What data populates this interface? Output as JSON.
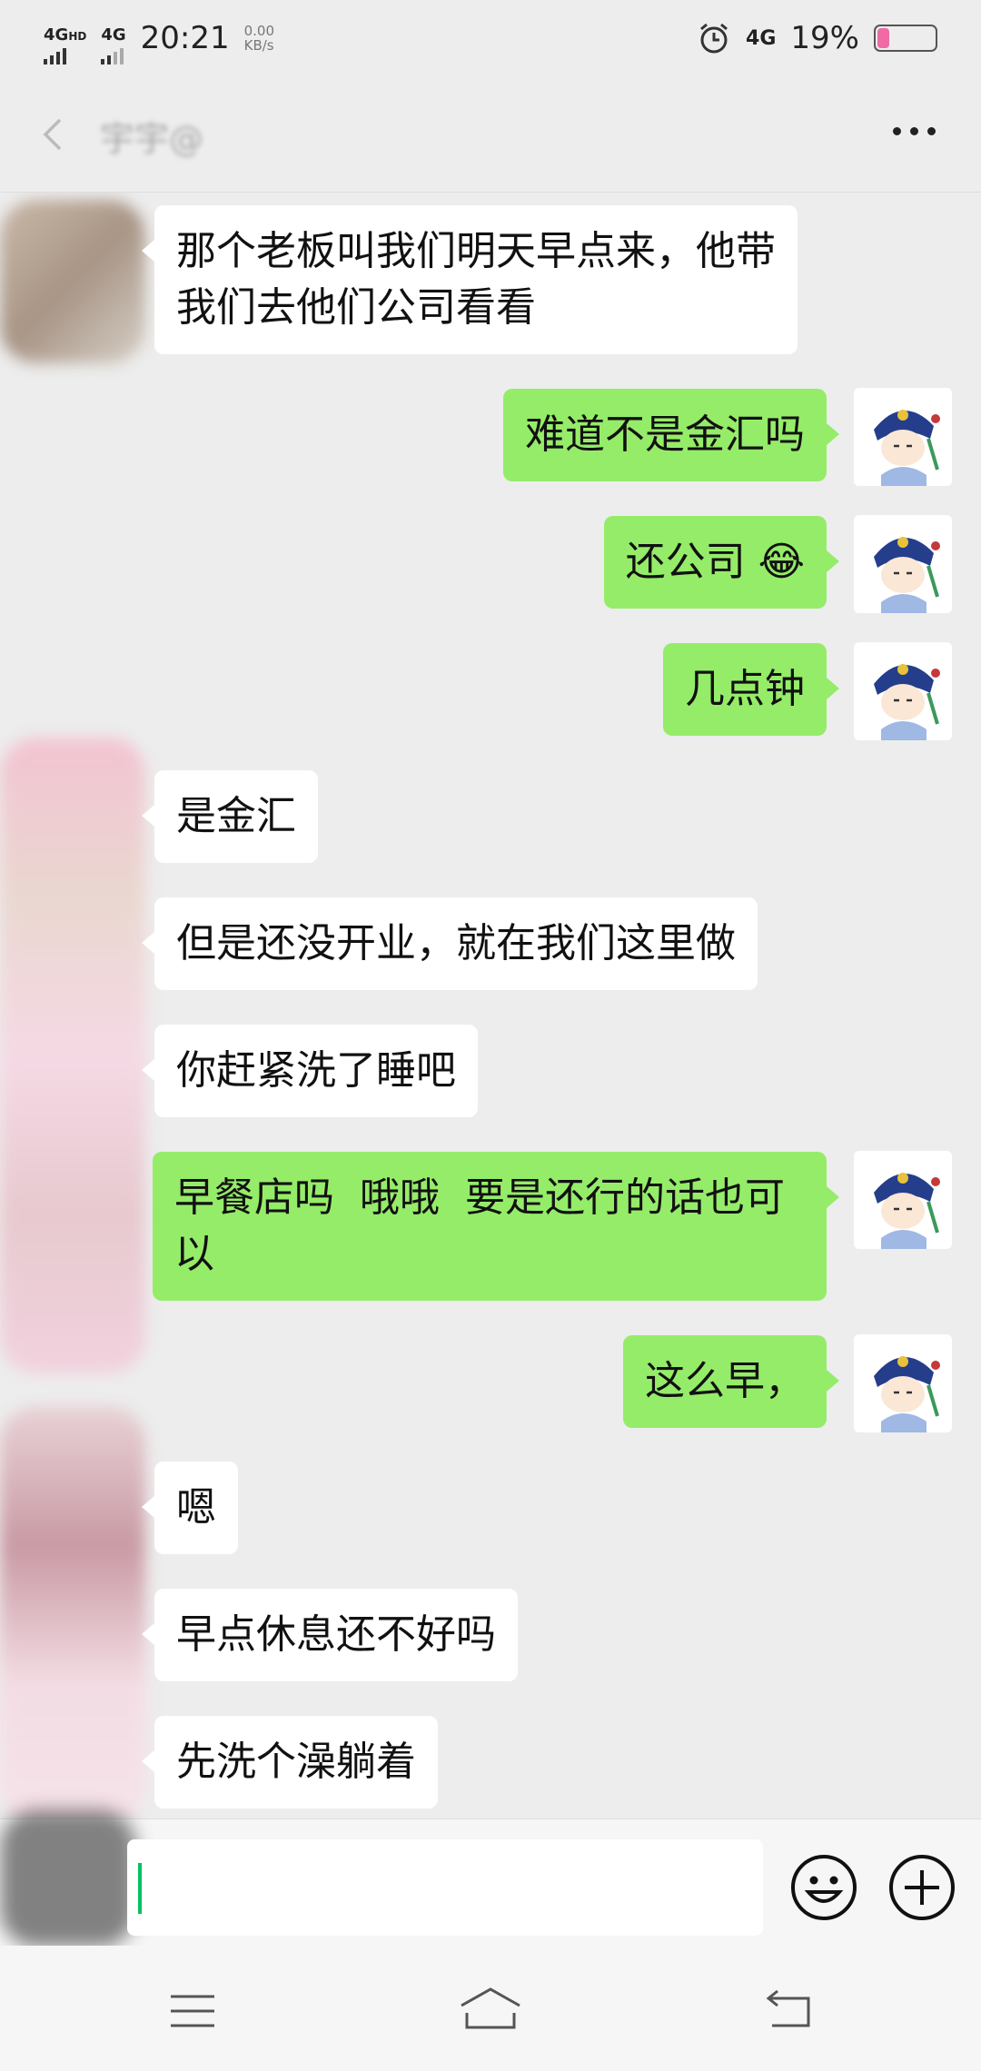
{
  "status_bar": {
    "network_1": "4G",
    "network_1_suffix": "HD",
    "network_2": "4G",
    "time": "20:21",
    "net_speed_value": "0.00",
    "net_speed_unit": "KB/s",
    "network_3": "4G",
    "battery_percent": "19%",
    "battery_level": 0.19
  },
  "header": {
    "title": "宇宇@",
    "icons": [
      "back-icon",
      "more-icon"
    ]
  },
  "messages": [
    {
      "from": "other",
      "text": "那个老板叫我们明天早点来，他带\n我们去他们公司看看"
    },
    {
      "from": "me",
      "text": "难道不是金汇吗"
    },
    {
      "from": "me",
      "text": "还公司 😂"
    },
    {
      "from": "me",
      "text": "几点钟"
    },
    {
      "from": "other",
      "text": "是金汇"
    },
    {
      "from": "other",
      "text": "但是还没开业，就在我们这里做"
    },
    {
      "from": "other",
      "text": "你赶紧洗了睡吧"
    },
    {
      "from": "me",
      "text": "早餐店吗  哦哦  要是还行的话也可\n以"
    },
    {
      "from": "me",
      "text": "这么早，"
    },
    {
      "from": "other",
      "text": "嗯"
    },
    {
      "from": "other",
      "text": "早点休息还不好吗"
    },
    {
      "from": "other",
      "text": "先洗个澡躺着"
    }
  ],
  "input_bar": {
    "value": "",
    "icons": [
      "emoji-icon",
      "plus-icon"
    ]
  },
  "nav_bar": {
    "icons": [
      "menu-icon",
      "home-icon",
      "back-icon"
    ]
  },
  "colors": {
    "background": "#ededed",
    "outgoing_bubble": "#95ec69",
    "incoming_bubble": "#ffffff",
    "cursor": "#07c160",
    "battery": "#f06aa6"
  }
}
